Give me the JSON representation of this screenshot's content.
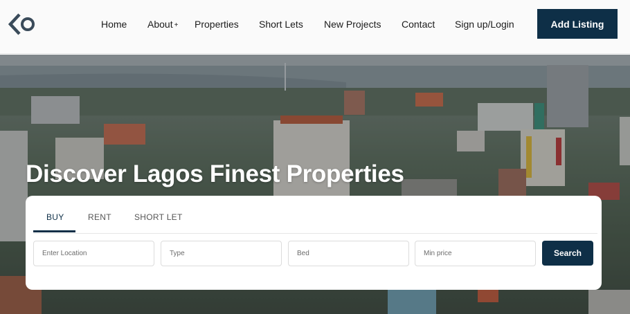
{
  "brand": {
    "logo_icon": "diamond-circle-logo-icon",
    "accent": "#0e2f47"
  },
  "nav": {
    "items": [
      {
        "label": "Home"
      },
      {
        "label": "About",
        "suffix": "+"
      },
      {
        "label": "Properties"
      },
      {
        "label": "Short Lets"
      },
      {
        "label": "New Projects"
      },
      {
        "label": "Contact"
      },
      {
        "label": "Sign up/Login"
      }
    ],
    "cta_label": "Add Listing"
  },
  "hero": {
    "title": "Discover Lagos Finest Properties",
    "background": "lagos-city-aerial-photo"
  },
  "search": {
    "tabs": [
      {
        "label": "BUY",
        "active": true
      },
      {
        "label": "RENT",
        "active": false
      },
      {
        "label": "SHORT LET",
        "active": false
      }
    ],
    "fields": [
      {
        "placeholder": "Enter Location"
      },
      {
        "placeholder": "Type"
      },
      {
        "placeholder": "Bed"
      },
      {
        "placeholder": "Min price"
      }
    ],
    "button_label": "Search"
  }
}
